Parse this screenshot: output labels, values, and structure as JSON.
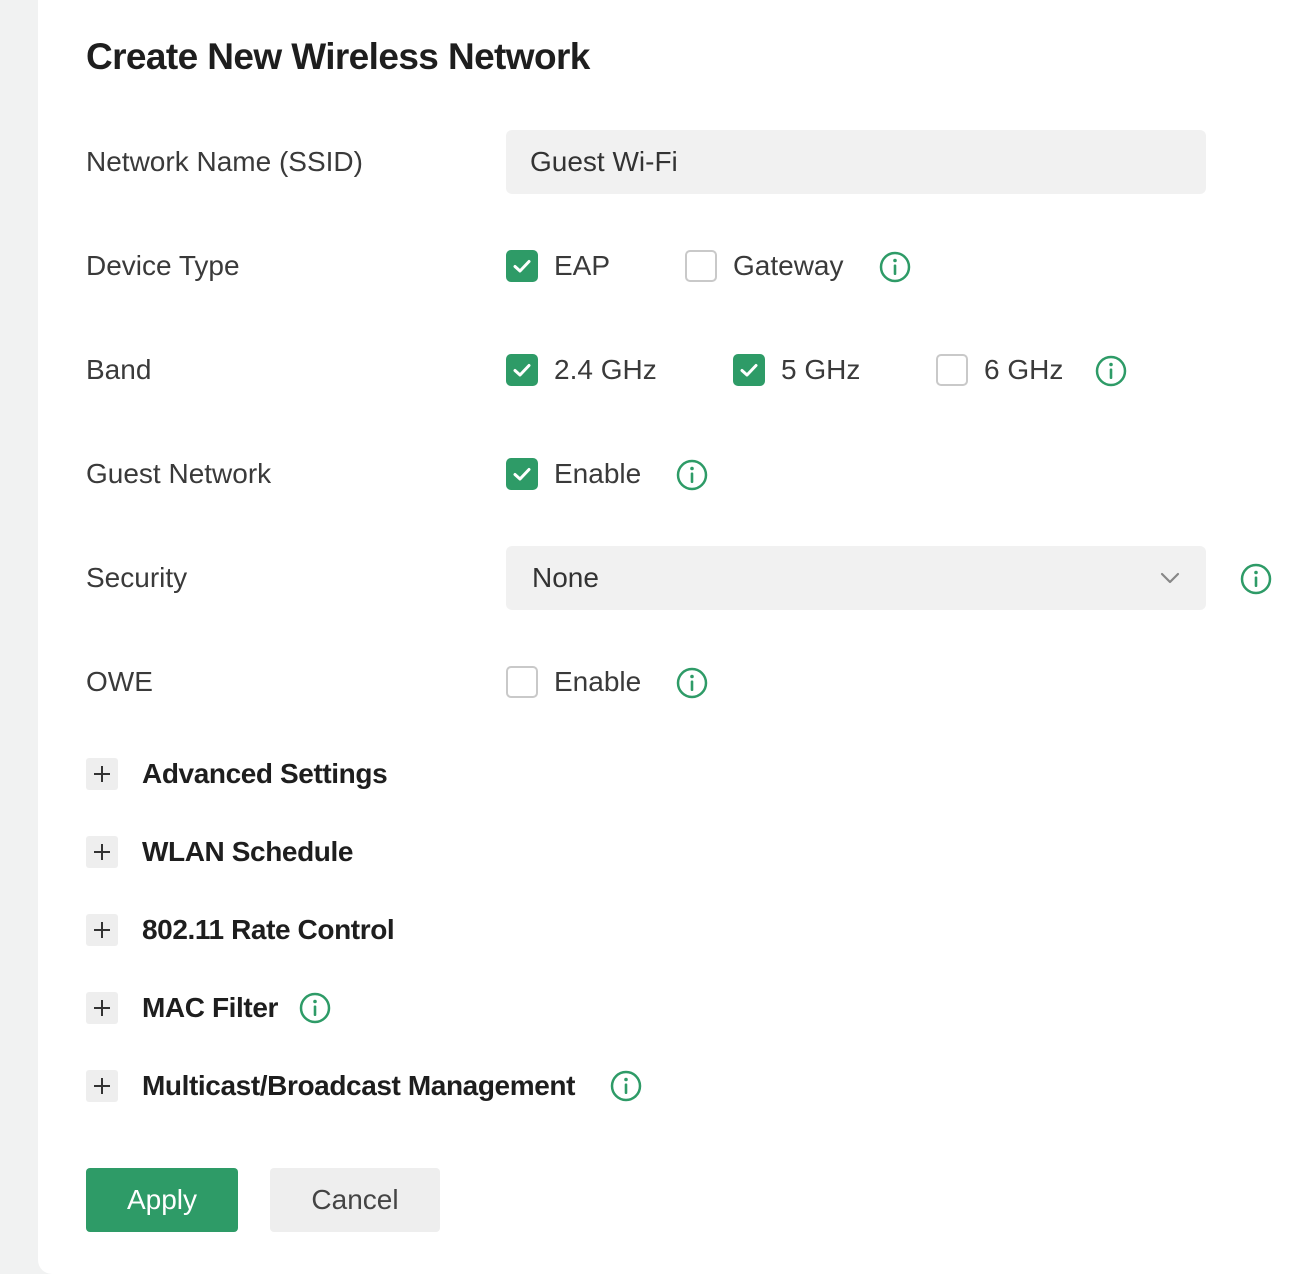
{
  "dialog": {
    "title": "Create New Wireless Network"
  },
  "ssid": {
    "label": "Network Name (SSID)",
    "value": "Guest Wi-Fi"
  },
  "device_type": {
    "label": "Device Type",
    "options": [
      {
        "label": "EAP",
        "checked": true
      },
      {
        "label": "Gateway",
        "checked": false
      }
    ]
  },
  "band": {
    "label": "Band",
    "options": [
      {
        "label": "2.4 GHz",
        "checked": true
      },
      {
        "label": "5 GHz",
        "checked": true
      },
      {
        "label": "6 GHz",
        "checked": false
      }
    ]
  },
  "guest_network": {
    "label": "Guest Network",
    "option_label": "Enable",
    "checked": true
  },
  "security": {
    "label": "Security",
    "selected": "None"
  },
  "owe": {
    "label": "OWE",
    "option_label": "Enable",
    "checked": false
  },
  "sections": [
    {
      "label": "Advanced Settings",
      "info": false
    },
    {
      "label": "WLAN Schedule",
      "info": false
    },
    {
      "label": "802.11 Rate Control",
      "info": false
    },
    {
      "label": "MAC Filter",
      "info": true
    },
    {
      "label": "Multicast/Broadcast Management",
      "info": true
    }
  ],
  "actions": {
    "apply_label": "Apply",
    "cancel_label": "Cancel"
  },
  "colors": {
    "accent": "#2e9b67",
    "field_bg": "#f1f1f1",
    "page_bg": "#f1f2f2"
  },
  "icons": {
    "info": "info-circle-icon",
    "expand": "plus-icon",
    "check": "check-icon",
    "dropdown": "chevron-down-icon"
  }
}
